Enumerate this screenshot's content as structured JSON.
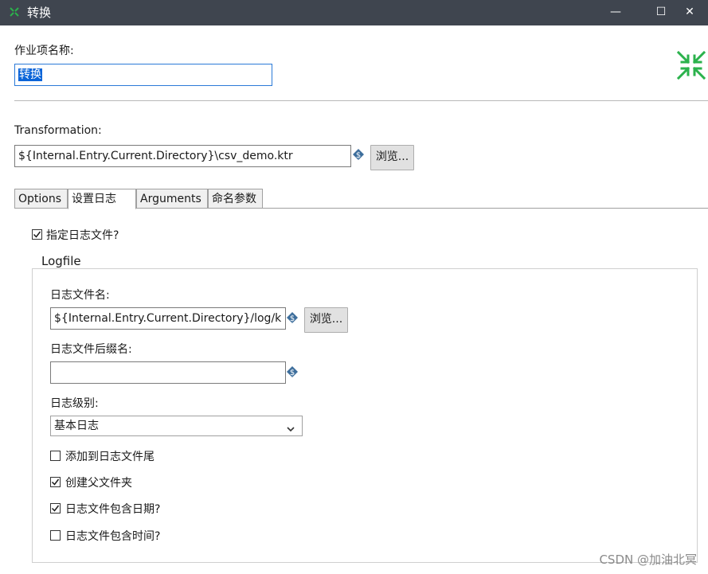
{
  "window": {
    "title": "转换",
    "minimize_glyph": "—",
    "maximize_glyph": "☐",
    "close_glyph": "✕"
  },
  "job_entry_name": {
    "label": "作业项名称:",
    "value": "转换"
  },
  "transformation": {
    "label": "Transformation:",
    "path": "${Internal.Entry.Current.Directory}\\csv_demo.ktr",
    "browse_label": "浏览..."
  },
  "tabs": [
    {
      "label": "Options",
      "active": false
    },
    {
      "label": "设置日志",
      "active": true
    },
    {
      "label": "Arguments",
      "active": false
    },
    {
      "label": "命名参数",
      "active": false
    }
  ],
  "log_settings": {
    "specify_logfile": {
      "label": "指定日志文件?",
      "checked": true
    },
    "group_title": "Logfile",
    "logfile_name": {
      "label": "日志文件名:",
      "value": "${Internal.Entry.Current.Directory}/log/k",
      "browse_label": "浏览..."
    },
    "logfile_ext": {
      "label": "日志文件后缀名:",
      "value": ""
    },
    "log_level": {
      "label": "日志级别:",
      "selected": "基本日志"
    },
    "options": [
      {
        "label": "添加到日志文件尾",
        "checked": false
      },
      {
        "label": "创建父文件夹",
        "checked": true
      },
      {
        "label": "日志文件包含日期?",
        "checked": true
      },
      {
        "label": "日志文件包含时间?",
        "checked": false
      }
    ]
  },
  "icons": {
    "app": "kettle-job-icon",
    "collapse": "collapse-arrows-icon",
    "variable": "variable-dollar-icon",
    "dropdown": "chevron-down-icon",
    "check": "checkmark-icon"
  },
  "colors": {
    "titlebar": "#3f454f",
    "accent_green": "#2bb24c",
    "selection": "#0a64d8",
    "variable_icon": "#3d6e9c"
  },
  "watermark": "CSDN @加油北冥"
}
